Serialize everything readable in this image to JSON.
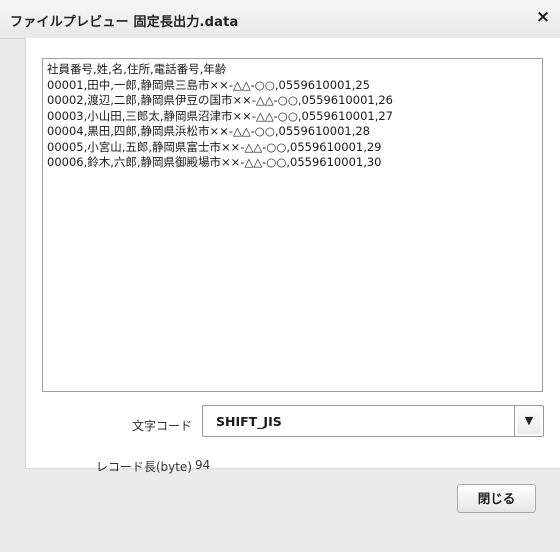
{
  "dialog": {
    "title": "ファイルプレビュー 固定長出力.data",
    "close_icon": "×"
  },
  "preview": {
    "lines": [
      "社員番号,姓,名,住所,電話番号,年齢",
      "00001,田中,一郎,静岡県三島市××-△△-○○,0559610001,25",
      "00002,渡辺,二郎,静岡県伊豆の国市××-△△-○○,0559610001,26",
      "00003,小山田,三郎太,静岡県沼津市××-△△-○○,0559610001,27",
      "00004,黒田,四郎,静岡県浜松市××-△△-○○,0559610001,28",
      "00005,小宮山,五郎,静岡県富士市××-△△-○○,0559610001,29",
      "00006,鈴木,六郎,静岡県御殿場市××-△△-○○,0559610001,30"
    ]
  },
  "encoding": {
    "label": "文字コード",
    "selected": "SHIFT_JIS",
    "arrow": "▼"
  },
  "record_length": {
    "label": "レコード長(byte)",
    "value": "94"
  },
  "footer": {
    "close_label": "閉じる"
  }
}
